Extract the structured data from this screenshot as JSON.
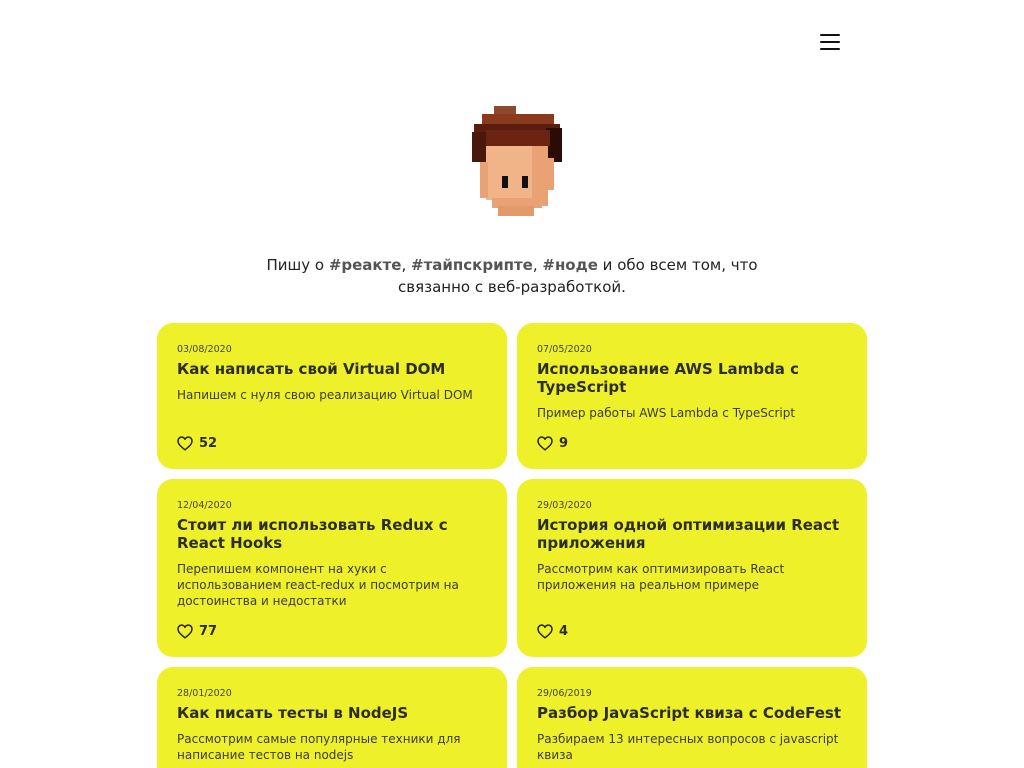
{
  "header": {
    "menu_icon": "hamburger-menu-icon",
    "avatar_icon": "pixel-art-avatar"
  },
  "intro": {
    "prefix": "Пишу о ",
    "tag1": "#реакте",
    "sep1": ", ",
    "tag2": "#тайпскрипте",
    "sep2": ", ",
    "tag3": "#ноде",
    "suffix": " и обо всем том, что связанно с веб-разработкой."
  },
  "colors": {
    "card_bg": "#eef12a",
    "tag_text": "#555555"
  },
  "posts": [
    {
      "date": "03/08/2020",
      "title": "Как написать свой Virtual DOM",
      "description": "Напишем с нуля свою реализацию Virtual DOM",
      "likes": "52"
    },
    {
      "date": "07/05/2020",
      "title": "Использование AWS Lambda с TypeScript",
      "description": "Пример работы AWS Lambda с TypeScript",
      "likes": "9"
    },
    {
      "date": "12/04/2020",
      "title": "Стоит ли использовать Redux с React Hooks",
      "description": "Перепишем компонент на хуки с использованием react-redux и посмотрим на достоинства и недостатки",
      "likes": "77"
    },
    {
      "date": "29/03/2020",
      "title": "История одной оптимизации React приложения",
      "description": "Рассмотрим как оптимизировать React приложения на реальном примере",
      "likes": "4"
    },
    {
      "date": "28/01/2020",
      "title": "Как писать тесты в NodeJS",
      "description": "Рассмотрим самые популярные техники для написание тестов на nodejs"
    },
    {
      "date": "29/06/2019",
      "title": "Разбор JavaScript квиза с CodeFest",
      "description": "Разбираем 13 интересных вопросов с javascript квиза"
    }
  ]
}
